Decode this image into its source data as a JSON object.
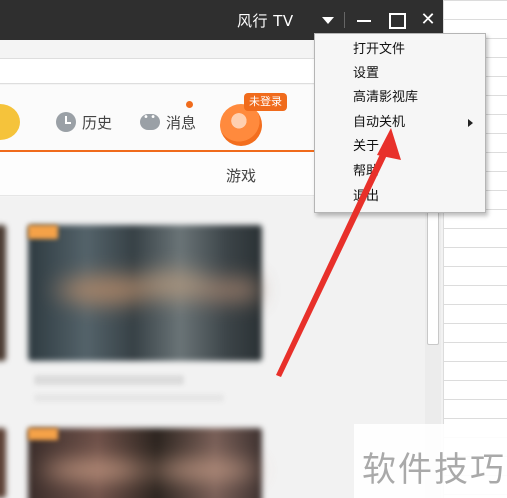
{
  "window": {
    "title": "风行 TV"
  },
  "nav": {
    "history_label": "历史",
    "messages_label": "消息",
    "login_badge": "未登录"
  },
  "categories": {
    "game_label": "游戏"
  },
  "context_menu": {
    "items": [
      {
        "label": "打开文件"
      },
      {
        "label": "设置"
      },
      {
        "label": "高清影视库"
      },
      {
        "label": "自动关机",
        "has_submenu": true
      },
      {
        "label": "关于"
      },
      {
        "label": "帮助"
      },
      {
        "label": "退出"
      }
    ]
  },
  "annotation": {
    "arrow_color": "#e8302a"
  },
  "watermark": {
    "text": "软件技巧"
  },
  "colors": {
    "accent": "#f06b1c",
    "titlebar": "#2f2f2f"
  }
}
